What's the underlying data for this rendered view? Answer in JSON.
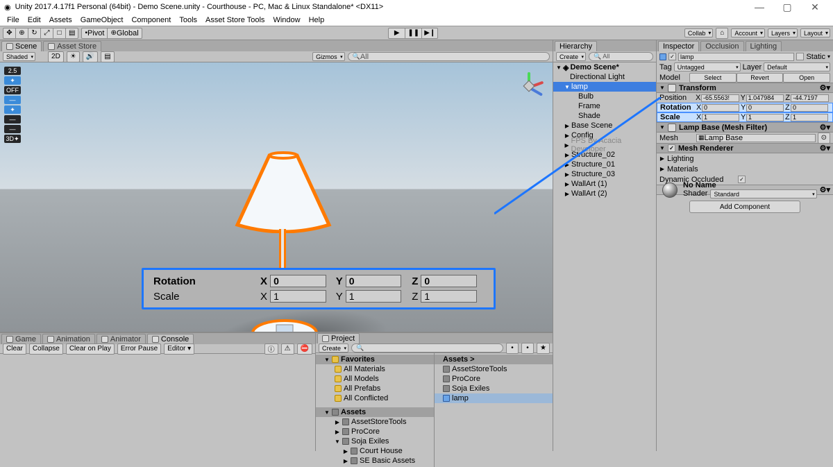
{
  "window": {
    "title": "Unity 2017.4.17f1 Personal (64bit) - Demo Scene.unity - Courthouse - PC, Mac & Linux Standalone* <DX11>",
    "min": "—",
    "max": "▢",
    "close": "✕"
  },
  "menu": [
    "File",
    "Edit",
    "Assets",
    "GameObject",
    "Component",
    "Tools",
    "Asset Store Tools",
    "Window",
    "Help"
  ],
  "toolbar": {
    "tools": [
      "✥",
      "⊕",
      "↻",
      "⤢",
      "□",
      "▤"
    ],
    "pivot": "Pivot",
    "global": "Global",
    "play": "▶",
    "pause": "❚❚",
    "step": "▶❙",
    "collab": "Collab",
    "cloud": "⌂",
    "account": "Account",
    "layers": "Layers",
    "layout": "Layout"
  },
  "sceneTabs": {
    "scene": "Scene",
    "assetStore": "Asset Store"
  },
  "sceneStrip": {
    "shaded": "Shaded",
    "dim": "2D",
    "gizmos": "Gizmos",
    "all": "All"
  },
  "controls": [
    "2.5",
    "✦",
    "OFF",
    "—",
    "✦",
    "—",
    "—",
    "3D✦"
  ],
  "lamp": {
    "shadeStroke": "#ff7a00",
    "shadeFill": "#f4f8fb"
  },
  "callout": {
    "rotation": {
      "label": "Rotation",
      "x": "0",
      "y": "0",
      "z": "0"
    },
    "scale": {
      "label": "Scale",
      "x": "1",
      "y": "1",
      "z": "1"
    }
  },
  "hierarchy": {
    "title": "Hierarchy",
    "create": "Create",
    "root": "Demo Scene*",
    "items": [
      {
        "indent": 1,
        "name": "Directional Light"
      },
      {
        "indent": 1,
        "name": "lamp",
        "sel": true,
        "open": true
      },
      {
        "indent": 2,
        "name": "Bulb"
      },
      {
        "indent": 2,
        "name": "Frame"
      },
      {
        "indent": 2,
        "name": "Shade"
      },
      {
        "indent": 1,
        "name": "Base Scene",
        "tri": true
      },
      {
        "indent": 1,
        "name": "Config",
        "tri": true
      },
      {
        "indent": 1,
        "name": "FPS By Acacia Developer",
        "tri": true,
        "grey": true
      },
      {
        "indent": 1,
        "name": "Structure_02",
        "tri": true
      },
      {
        "indent": 1,
        "name": "Structure_01",
        "tri": true
      },
      {
        "indent": 1,
        "name": "Structure_03",
        "tri": true
      },
      {
        "indent": 1,
        "name": "WallArt (1)",
        "tri": true
      },
      {
        "indent": 1,
        "name": "WallArt (2)",
        "tri": true
      }
    ]
  },
  "bottom": {
    "leftTabs": [
      "Game",
      "Animation",
      "Animator",
      "Console"
    ],
    "consoleBtns": [
      "Clear",
      "Collapse",
      "Clear on Play",
      "Error Pause",
      "Editor ▾"
    ],
    "projectTab": "Project",
    "create": "Create",
    "favorites": {
      "label": "Favorites",
      "items": [
        "All Materials",
        "All Models",
        "All Prefabs",
        "All Conflicted"
      ]
    },
    "assets": {
      "label": "Assets",
      "items": [
        {
          "name": "AssetStoreTools"
        },
        {
          "name": "ProCore"
        },
        {
          "name": "Soja Exiles",
          "open": true,
          "children": [
            "Court House",
            "SE Basic Assets"
          ]
        }
      ]
    },
    "assetsCol": {
      "title": "Assets >",
      "items": [
        "AssetStoreTools",
        "ProCore",
        "Soja Exiles",
        "lamp"
      ]
    }
  },
  "inspector": {
    "tabs": [
      "Inspector",
      "Occlusion",
      "Lighting"
    ],
    "name": "lamp",
    "static": "Static",
    "tag": "Tag",
    "tagVal": "Untagged",
    "layer": "Layer",
    "layerVal": "Default",
    "modelRow": {
      "model": "Model",
      "select": "Select",
      "revert": "Revert",
      "open": "Open"
    },
    "transform": {
      "title": "Transform",
      "position": {
        "label": "Position",
        "x": "-65.5563!",
        "y": "1.047984",
        "z": "-44.7197"
      },
      "rotation": {
        "label": "Rotation",
        "x": "0",
        "y": "0",
        "z": "0"
      },
      "scale": {
        "label": "Scale",
        "x": "1",
        "y": "1",
        "z": "1"
      }
    },
    "meshFilter": {
      "title": "Lamp Base (Mesh Filter)",
      "meshLabel": "Mesh",
      "meshVal": "Lamp Base"
    },
    "meshRenderer": {
      "title": "Mesh Renderer",
      "lighting": "Lighting",
      "materials": "Materials",
      "dynOcc": "Dynamic Occluded"
    },
    "material": {
      "name": "No Name",
      "shaderLabel": "Shader",
      "shaderVal": "Standard"
    },
    "addComp": "Add Component"
  }
}
